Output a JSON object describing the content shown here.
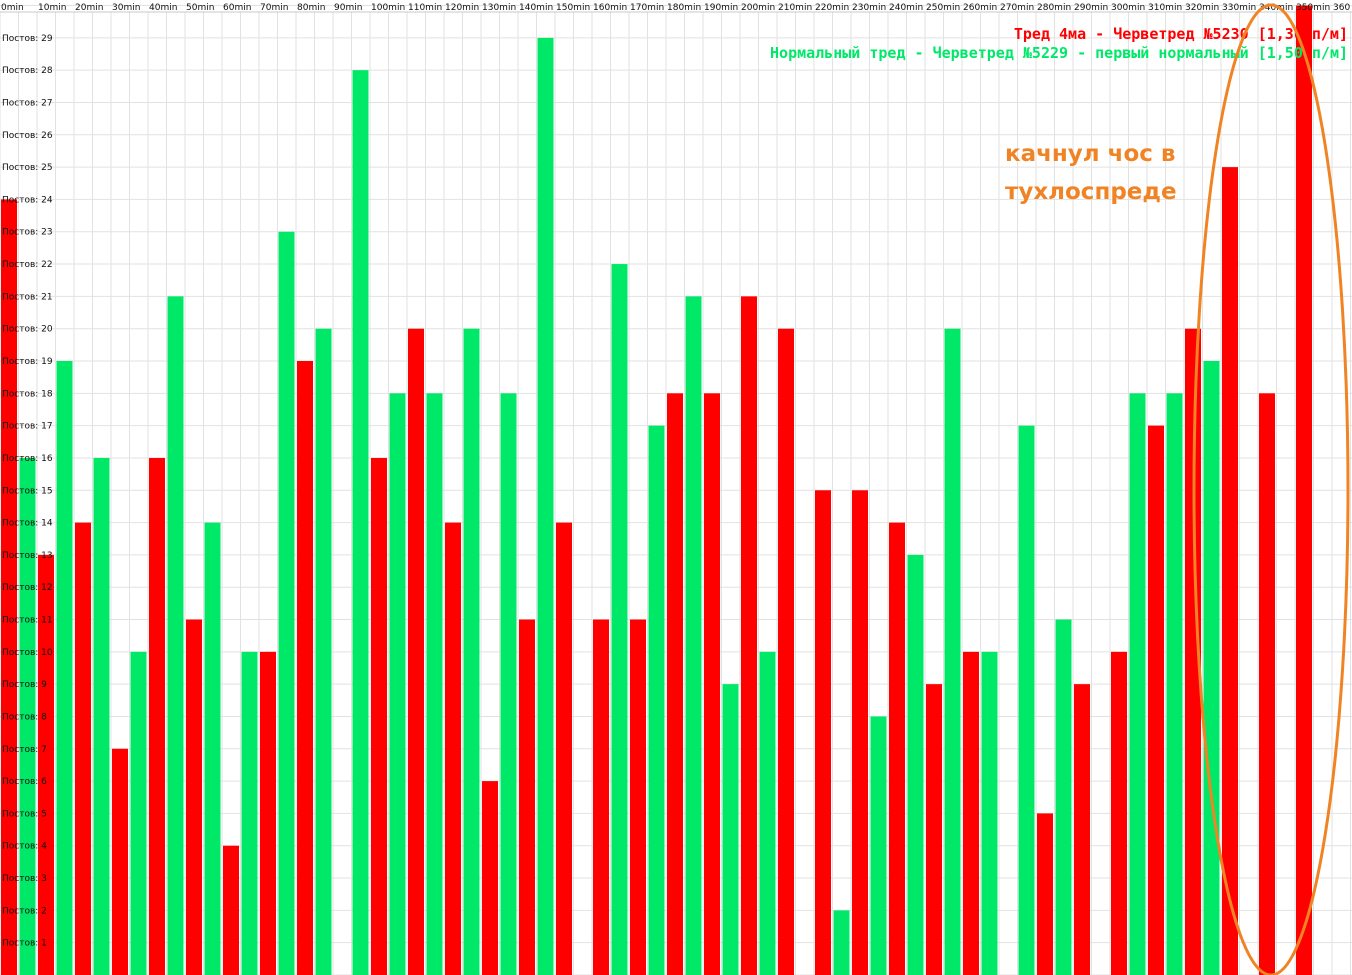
{
  "chart_data": {
    "type": "bar",
    "x_unit": "min",
    "x_ticks": [
      "0min",
      "10min",
      "20min",
      "30min",
      "40min",
      "50min",
      "60min",
      "70min",
      "80min",
      "90min",
      "100min",
      "110min",
      "120min",
      "130min",
      "140min",
      "150min",
      "160min",
      "170min",
      "180min",
      "190min",
      "200min",
      "210min",
      "220min",
      "230min",
      "240min",
      "250min",
      "260min",
      "270min",
      "280min",
      "290min",
      "300min",
      "310min",
      "320min",
      "330min",
      "340min",
      "350min",
      "360"
    ],
    "y_label": "Постов:",
    "y_ticks": [
      1,
      2,
      3,
      4,
      5,
      6,
      7,
      8,
      9,
      10,
      11,
      12,
      13,
      14,
      15,
      16,
      17,
      18,
      19,
      20,
      21,
      22,
      23,
      24,
      25,
      26,
      27,
      28,
      29
    ],
    "ylim": [
      0,
      29.8
    ],
    "grid": true,
    "legend_position": "top-right",
    "series": [
      {
        "name": "Тред 4ма - Черветред №5230 [1,36 п/м]",
        "color": "#ff0000",
        "x": [
          0,
          5,
          10,
          15,
          20,
          25,
          30,
          35,
          40,
          45,
          50,
          55,
          60,
          65,
          70,
          75,
          80,
          85,
          90,
          95,
          100,
          105,
          110,
          115,
          120,
          125,
          130,
          135,
          140,
          145,
          150,
          155,
          160,
          165,
          170,
          175,
          180,
          185,
          190,
          195,
          200,
          205,
          210,
          215,
          220,
          225,
          230,
          235,
          240,
          245,
          250,
          255,
          260,
          265,
          270,
          275,
          280,
          285,
          290,
          295,
          300,
          305,
          310,
          315,
          320,
          325,
          330,
          335,
          340,
          345,
          350
        ],
        "values": [
          24,
          0,
          13,
          0,
          14,
          0,
          7,
          0,
          16,
          0,
          11,
          0,
          4,
          0,
          10,
          0,
          19,
          0,
          0,
          0,
          16,
          0,
          20,
          0,
          14,
          0,
          6,
          0,
          11,
          0,
          14,
          0,
          11,
          0,
          11,
          0,
          18,
          0,
          18,
          0,
          21,
          0,
          20,
          0,
          15,
          0,
          15,
          0,
          14,
          0,
          9,
          0,
          10,
          0,
          0,
          0,
          5,
          0,
          9,
          0,
          10,
          0,
          17,
          0,
          20,
          0,
          25,
          0,
          18,
          0,
          30
        ]
      },
      {
        "name": "Нормальный тред - Черветред №5229 - первый нормальный [1,50 п/м]",
        "color": "#00e868",
        "x": [
          0,
          5,
          10,
          15,
          20,
          25,
          30,
          35,
          40,
          45,
          50,
          55,
          60,
          65,
          70,
          75,
          80,
          85,
          90,
          95,
          100,
          105,
          110,
          115,
          120,
          125,
          130,
          135,
          140,
          145,
          150,
          155,
          160,
          165,
          170,
          175,
          180,
          185,
          190,
          195,
          200,
          205,
          210,
          215,
          220,
          225,
          230,
          235,
          240,
          245,
          250,
          255,
          260,
          265,
          270,
          275,
          280,
          285,
          290,
          295,
          300,
          305,
          310,
          315,
          320,
          325,
          330,
          335,
          340,
          345,
          350
        ],
        "values": [
          0,
          16,
          0,
          19,
          0,
          16,
          0,
          10,
          0,
          21,
          0,
          14,
          0,
          10,
          0,
          23,
          0,
          20,
          0,
          28,
          0,
          18,
          0,
          18,
          0,
          20,
          0,
          18,
          0,
          29,
          0,
          0,
          0,
          22,
          0,
          17,
          0,
          21,
          0,
          9,
          0,
          10,
          0,
          0,
          0,
          2,
          0,
          8,
          0,
          13,
          0,
          20,
          0,
          10,
          0,
          17,
          0,
          11,
          0,
          0,
          0,
          18,
          0,
          18,
          0,
          19,
          0,
          0,
          0,
          0,
          0
        ]
      }
    ],
    "annotations": [
      {
        "text_lines": [
          "качнул чос в",
          "тухлоспреде"
        ],
        "color": "#f08424"
      }
    ]
  },
  "colors": {
    "background": "#ffffff",
    "grid": "#e2e2e2",
    "annotation": "#f08424"
  }
}
